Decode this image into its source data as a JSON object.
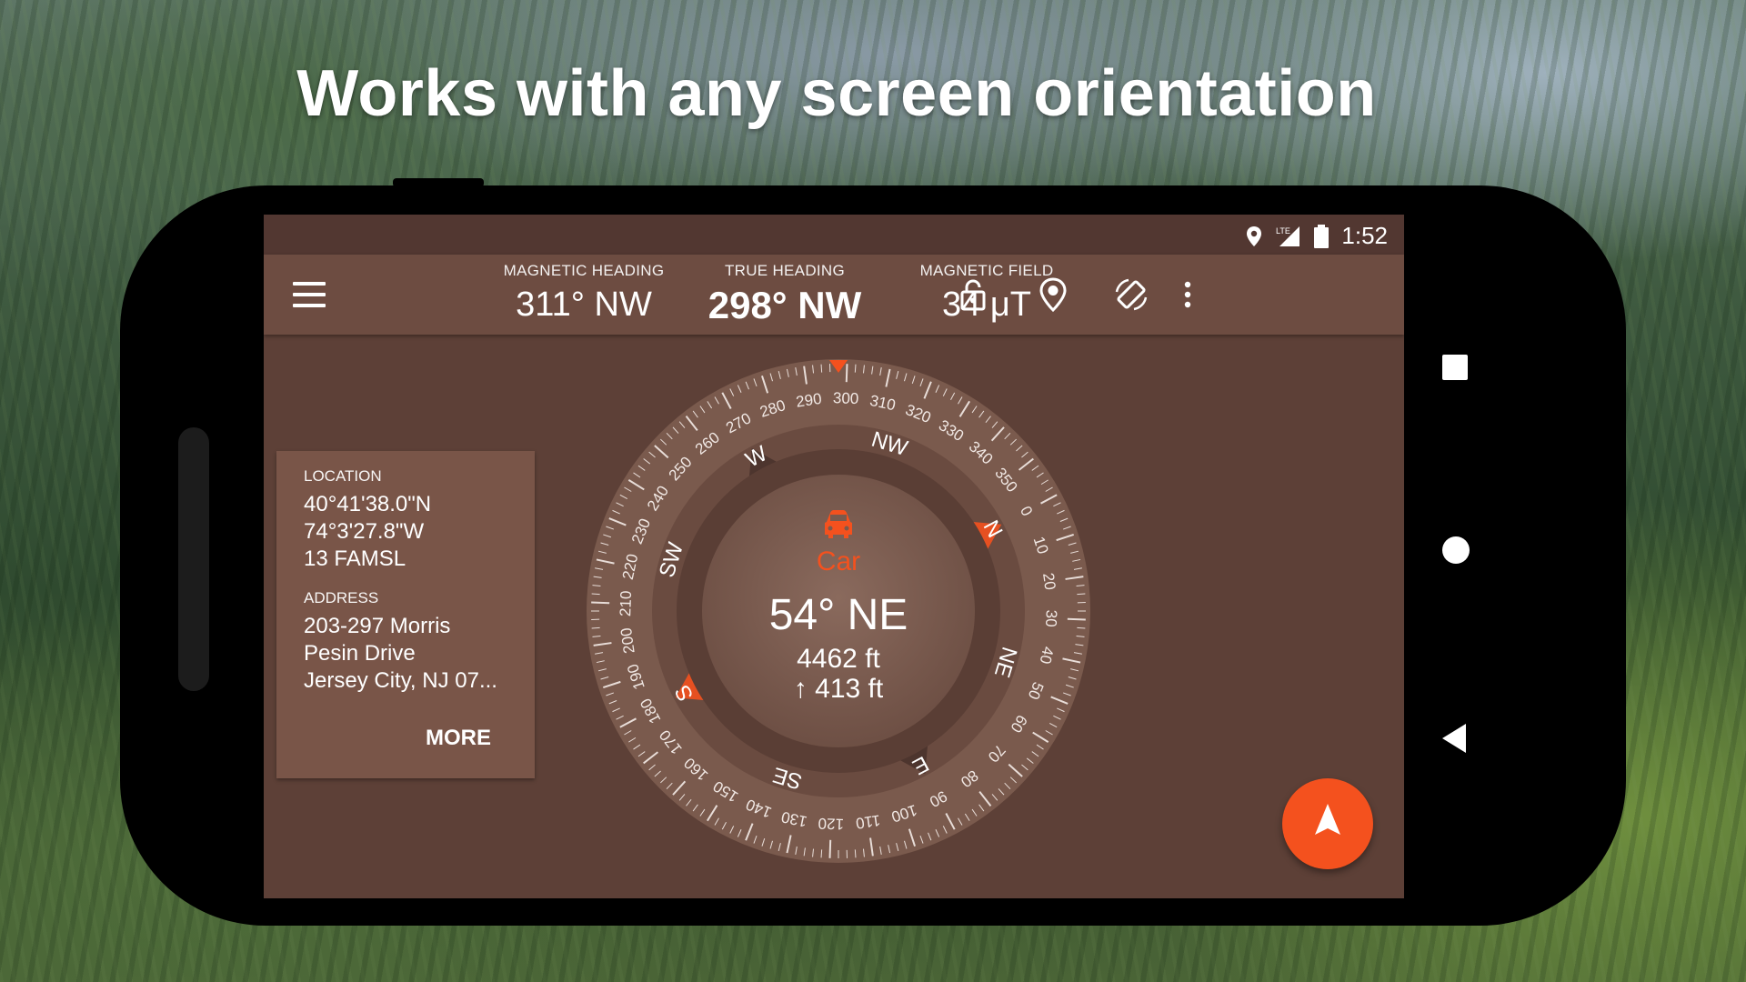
{
  "headline": "Works with any screen orientation",
  "status_bar": {
    "time": "1:52",
    "network": "LTE"
  },
  "app_bar": {
    "magnetic_heading": {
      "label": "MAGNETIC HEADING",
      "value": "311° NW"
    },
    "true_heading": {
      "label": "TRUE HEADING",
      "value": "298° NW"
    },
    "magnetic_field": {
      "label": "MAGNETIC FIELD",
      "value": "34 μT"
    },
    "icons": [
      "menu-icon",
      "lock-icon",
      "location-pin-icon",
      "screen-rotation-icon",
      "more-vert-icon"
    ]
  },
  "location_card": {
    "location_label": "LOCATION",
    "latitude": "40°41'38.0\"N",
    "longitude": "74°3'27.8\"W",
    "altitude": "13 FAMSL",
    "address_label": "ADDRESS",
    "address_line1": "203-297 Morris",
    "address_line2": "Pesin Drive",
    "address_line3": "Jersey City, NJ 07...",
    "more_label": "MORE"
  },
  "compass": {
    "heading_degrees": 298,
    "cardinals": [
      "N",
      "NE",
      "E",
      "SE",
      "S",
      "SW",
      "W",
      "NW"
    ],
    "tick_labels": [
      "0",
      "10",
      "20",
      "30",
      "40",
      "50",
      "60",
      "70",
      "80",
      "90",
      "100",
      "110",
      "120",
      "130",
      "140",
      "150",
      "160",
      "170",
      "180",
      "190",
      "200",
      "210",
      "220",
      "230",
      "240",
      "250",
      "260",
      "270",
      "280",
      "290",
      "300",
      "310",
      "320",
      "330",
      "340",
      "350"
    ],
    "target": {
      "mode": "Car",
      "bearing": "54° NE",
      "distance": "4462 ft",
      "elevation": "↑ 413 ft"
    }
  },
  "colors": {
    "screen_bg": "#5d4037",
    "app_bar": "#6d4c41",
    "accent": "#f4511e"
  }
}
